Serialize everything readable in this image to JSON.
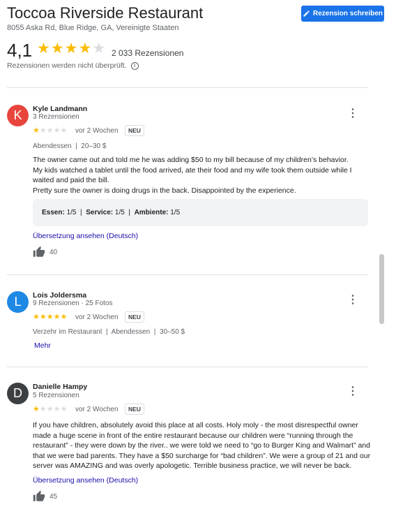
{
  "header": {
    "title": "Toccoa Riverside Restaurant",
    "address": "8055 Aska Rd, Blue Ridge, GA, Vereinigte Staaten",
    "write_review_label": "Rezension schreiben",
    "rating": "4,1",
    "rating_stars": 4.1,
    "reviews_count": "2 033 Rezensionen",
    "unverified_note": "Rezensionen werden nicht überprüft.",
    "info_glyph": "i"
  },
  "colors": {
    "accent": "#1a73e8",
    "star": "#fbbc04",
    "link": "#1a0dab"
  },
  "reviews": [
    {
      "initial": "K",
      "avatar_color": "#e8453c",
      "name": "Kyle Landmann",
      "sub": "3 Rezensionen",
      "stars": 1,
      "when": "vor 2 Wochen",
      "badge": "NEU",
      "meta": "Abendessen  |  20–30 $",
      "text": [
        "The owner came out and told me he was adding $50 to my bill because of my children’s behavior.",
        "My kids watched a tablet until the food arrived, ate their food and my wife took them outside while I waited and paid the bill.",
        "Pretty sure the owner is doing drugs in the back. Disappointed by the experience."
      ],
      "attributes": {
        "essen_label": "Essen:",
        "essen_value": "1/5",
        "service_label": "Service:",
        "service_value": "1/5",
        "ambiente_label": "Ambiente:",
        "ambiente_value": "1/5",
        "sep": "|"
      },
      "translate_label": "Übersetzung ansehen (Deutsch)",
      "likes": "40"
    },
    {
      "initial": "L",
      "avatar_color": "#1e88e5",
      "name": "Lois Joldersma",
      "sub": "9 Rezensionen · 25 Fotos",
      "stars": 5,
      "when": "vor 2 Wochen",
      "badge": "NEU",
      "meta": "Verzehr im Restaurant  |  Abendessen  |  30–50 $",
      "more_label": "Mehr"
    },
    {
      "initial": "D",
      "avatar_color": "#3c4043",
      "name": "Danielle Hampy",
      "sub": "5 Rezensionen",
      "stars": 1,
      "when": "vor 2 Wochen",
      "badge": "NEU",
      "text": [
        "If you have children, absolutely avoid this place at all costs. Holy moly - the most disrespectful owner made a huge scene in front of the entire restaurant because our children were “running through the restaurant” - they were down by the river.. we were told we need to “go to Burger King and Walmart” and that we were bad parents. They have a $50 surcharge for “bad children”. We were a group of 21 and our server was AMAZING and was overly apologetic. Terrible business practice, we will never be back."
      ],
      "translate_label": "Übersetzung ansehen (Deutsch)",
      "likes": "45"
    }
  ],
  "icons": {
    "kebab": "⋮",
    "star": "★",
    "thumb": "thumb-up-icon",
    "pencil": "pencil-icon"
  }
}
